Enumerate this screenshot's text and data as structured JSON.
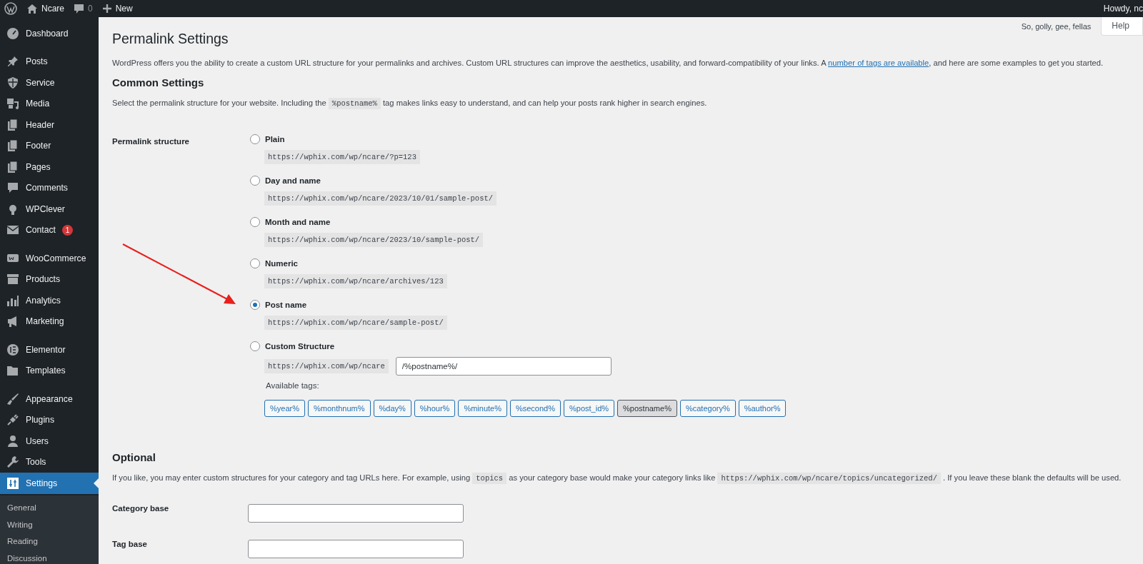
{
  "topbar": {
    "site_name": "Ncare",
    "comments_count": "0",
    "new_label": "New",
    "greeting": "Howdy, nc"
  },
  "sidebar": {
    "groups": [
      [
        {
          "label": "Dashboard",
          "selected": false
        }
      ],
      [
        {
          "label": "Posts",
          "selected": false
        },
        {
          "label": "Service",
          "selected": false
        },
        {
          "label": "Media",
          "selected": false
        },
        {
          "label": "Header",
          "selected": false
        },
        {
          "label": "Footer",
          "selected": false
        },
        {
          "label": "Pages",
          "selected": false
        },
        {
          "label": "Comments",
          "selected": false
        },
        {
          "label": "WPClever",
          "selected": false
        },
        {
          "label": "Contact",
          "selected": false,
          "badge": "1"
        }
      ],
      [
        {
          "label": "WooCommerce",
          "selected": false
        },
        {
          "label": "Products",
          "selected": false
        },
        {
          "label": "Analytics",
          "selected": false
        },
        {
          "label": "Marketing",
          "selected": false
        }
      ],
      [
        {
          "label": "Elementor",
          "selected": false
        },
        {
          "label": "Templates",
          "selected": false
        }
      ],
      [
        {
          "label": "Appearance",
          "selected": false
        },
        {
          "label": "Plugins",
          "selected": false
        },
        {
          "label": "Users",
          "selected": false
        },
        {
          "label": "Tools",
          "selected": false
        },
        {
          "label": "Settings",
          "selected": true
        }
      ]
    ],
    "submenu": [
      "General",
      "Writing",
      "Reading",
      "Discussion"
    ]
  },
  "header_meta": {
    "quote": "So, golly, gee, fellas",
    "help_tab": "Help"
  },
  "page": {
    "title": "Permalink Settings",
    "intro": [
      {
        "kind": "text",
        "text": "WordPress offers you the ability to create a custom URL structure for your permalinks and archives. Custom URL structures can improve the aesthetics, usability, and forward-compatibility of your links. A "
      },
      {
        "kind": "link",
        "text": "number of tags are available"
      },
      {
        "kind": "text",
        "text": ", and here are some examples to get you started."
      }
    ],
    "common_heading": "Common Settings",
    "common_text": [
      {
        "kind": "text",
        "text": "Select the permalink structure for your website. Including the "
      },
      {
        "kind": "code",
        "text": "%postname%"
      },
      {
        "kind": "text",
        "text": " tag makes links easy to understand, and can help your posts rank higher in search engines."
      }
    ],
    "structure_label": "Permalink structure",
    "options": [
      {
        "kind": "preset",
        "label": "Plain",
        "example": "https://wphix.com/wp/ncare/?p=123",
        "selected": false
      },
      {
        "kind": "preset",
        "label": "Day and name",
        "example": "https://wphix.com/wp/ncare/2023/10/01/sample-post/",
        "selected": false
      },
      {
        "kind": "preset",
        "label": "Month and name",
        "example": "https://wphix.com/wp/ncare/2023/10/sample-post/",
        "selected": false
      },
      {
        "kind": "preset",
        "label": "Numeric",
        "example": "https://wphix.com/wp/ncare/archives/123",
        "selected": false
      },
      {
        "kind": "preset",
        "label": "Post name",
        "example": "https://wphix.com/wp/ncare/sample-post/",
        "selected": true
      },
      {
        "kind": "custom",
        "label": "Custom Structure",
        "prefix": "https://wphix.com/wp/ncare",
        "value": "/%postname%/",
        "selected": false
      }
    ],
    "tags_label": "Available tags:",
    "tags": [
      {
        "label": "%year%",
        "selected": false
      },
      {
        "label": "%monthnum%",
        "selected": false
      },
      {
        "label": "%day%",
        "selected": false
      },
      {
        "label": "%hour%",
        "selected": false
      },
      {
        "label": "%minute%",
        "selected": false
      },
      {
        "label": "%second%",
        "selected": false
      },
      {
        "label": "%post_id%",
        "selected": false
      },
      {
        "label": "%postname%",
        "selected": true
      },
      {
        "label": "%category%",
        "selected": false
      },
      {
        "label": "%author%",
        "selected": false
      }
    ],
    "optional_heading": "Optional",
    "optional_text": [
      {
        "kind": "text",
        "text": "If you like, you may enter custom structures for your category and tag URLs here. For example, using "
      },
      {
        "kind": "code",
        "text": "topics"
      },
      {
        "kind": "text",
        "text": " as your category base would make your category links like "
      },
      {
        "kind": "code",
        "text": "https://wphix.com/wp/ncare/topics/uncategorized/"
      },
      {
        "kind": "text",
        "text": " . If you leave these blank the defaults will be used."
      }
    ],
    "fields": [
      {
        "label": "Category base"
      },
      {
        "label": "Tag base"
      }
    ]
  }
}
